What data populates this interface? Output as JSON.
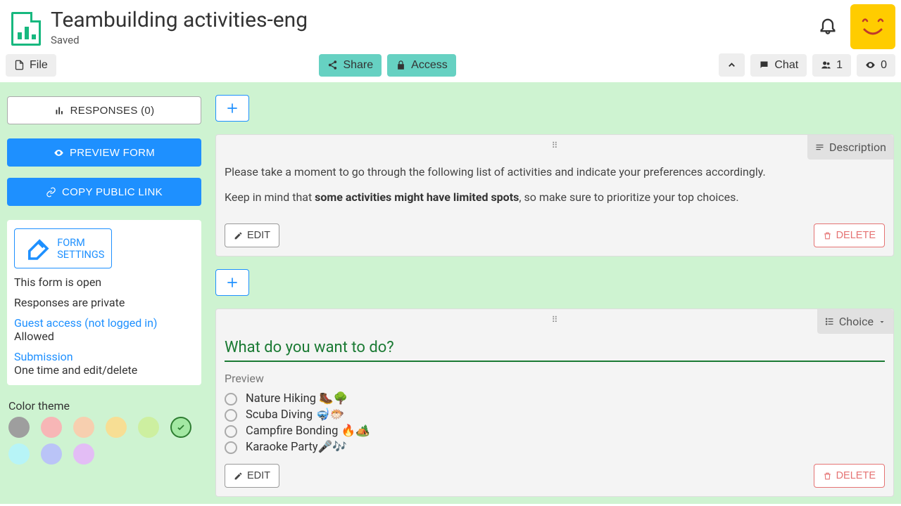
{
  "header": {
    "title": "Teambuilding activities-eng",
    "status": "Saved"
  },
  "toolbar": {
    "file": "File",
    "share": "Share",
    "access": "Access",
    "chat": "Chat",
    "people_count": "1",
    "views_count": "0"
  },
  "sidebar": {
    "responses": "RESPONSES (0)",
    "preview": "PREVIEW FORM",
    "copylink": "COPY PUBLIC LINK",
    "settings_label": "FORM SETTINGS",
    "open_line": "This form is open",
    "private_line": "Responses are private",
    "guest_link": "Guest access (not logged in)",
    "guest_val": "Allowed",
    "sub_link": "Submission",
    "sub_val": "One time and edit/delete",
    "color_label": "Color theme",
    "swatches": [
      {
        "c": "#9e9e9e",
        "sel": false
      },
      {
        "c": "#F7B6B6",
        "sel": false
      },
      {
        "c": "#F7CFAF",
        "sel": false
      },
      {
        "c": "#F7DE94",
        "sel": false
      },
      {
        "c": "#CDEFA0",
        "sel": false
      },
      {
        "c": "#A3E8A3",
        "sel": true
      },
      {
        "c": "#B7F4F7",
        "sel": false
      },
      {
        "c": "#BAC4F7",
        "sel": false
      },
      {
        "c": "#E3BDF5",
        "sel": false
      }
    ]
  },
  "blocks": {
    "desc": {
      "type_label": "Description",
      "p1": "Please take a moment to go through the following list of activities and indicate your preferences accordingly.",
      "p2a": "Keep in mind that ",
      "p2strong": "some activities might have limited spots",
      "p2b": ", so make sure to prioritize your top choices."
    },
    "choice": {
      "type_label": "Choice",
      "question": "What do you want to do?",
      "preview": "Preview",
      "options": [
        "Nature Hiking 🥾🌳",
        "Scuba Diving 🤿🐡",
        "Campfire Bonding 🔥🏕️",
        "Karaoke Party🎤🎶"
      ]
    },
    "edit": "EDIT",
    "delete": "DELETE"
  }
}
